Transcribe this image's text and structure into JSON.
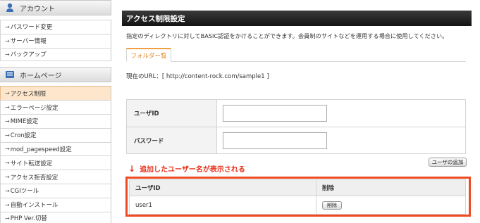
{
  "sidebar": {
    "account": {
      "title": "アカウント",
      "items": [
        {
          "label": "パスワード変更"
        },
        {
          "label": "サーバー情報"
        },
        {
          "label": "バックアップ"
        }
      ]
    },
    "homepage": {
      "title": "ホームページ",
      "items": [
        {
          "label": "アクセス制限",
          "active": true
        },
        {
          "label": "エラーページ設定"
        },
        {
          "label": "MIME設定"
        },
        {
          "label": "Cron設定"
        },
        {
          "label": "mod_pagespeed設定"
        },
        {
          "label": "サイト転送設定"
        },
        {
          "label": "アクセス拒否設定"
        },
        {
          "label": "CGIツール"
        },
        {
          "label": "自動インストール"
        },
        {
          "label": "PHP Ver.切替"
        }
      ]
    }
  },
  "main": {
    "title": "アクセス制限設定",
    "description": "指定のディレクトリに対してBASIC認証をかけることができます。会員制のサイトなどを運用する場合に使用してください。",
    "tab": "フォルダー覧",
    "url_line": "現在のURL：[ http://content-rock.com/sample1 ]",
    "form": {
      "user_id_label": "ユーザID",
      "user_id_value": "",
      "password_label": "パスワード",
      "password_value": ""
    },
    "add_user_button": "ユーザの追加",
    "annotation": "追加したユーザー名が表示される",
    "user_table": {
      "headers": [
        "ユーザID",
        "削除"
      ],
      "rows": [
        {
          "user": "user1",
          "delete_label": "削除"
        }
      ]
    }
  },
  "colors": {
    "active_item_bg": "#fde6cc",
    "tab_accent": "#f0a040",
    "annotation_red": "#e8321c",
    "highlight_frame": "#f04a22",
    "title_bar": "#1e1e1e"
  }
}
